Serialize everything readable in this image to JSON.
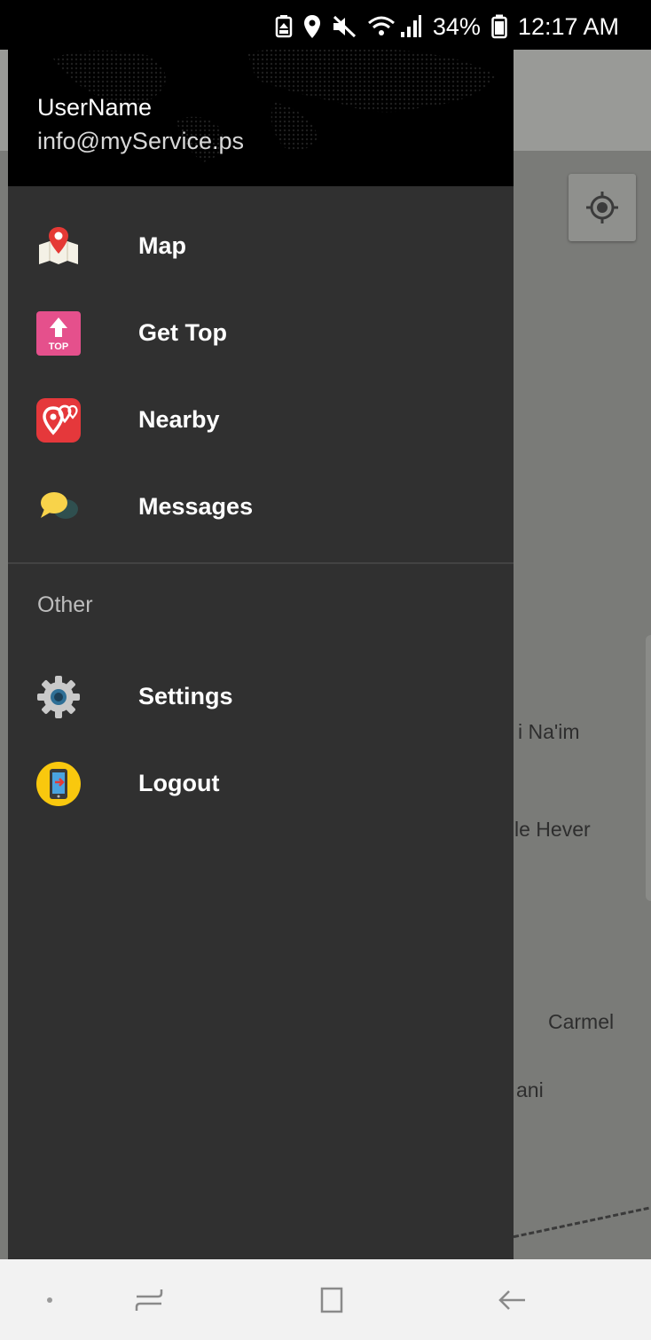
{
  "status_bar": {
    "battery_percent": "34%",
    "time": "12:17 AM"
  },
  "drawer": {
    "header": {
      "user_name": "UserName",
      "email": "info@myService.ps"
    },
    "main_items": [
      {
        "label": "Map",
        "icon": "map-pin-icon"
      },
      {
        "label": "Get Top",
        "icon": "top-arrow-icon"
      },
      {
        "label": "Nearby",
        "icon": "nearby-pins-icon"
      },
      {
        "label": "Messages",
        "icon": "chat-bubble-icon"
      }
    ],
    "section_title": "Other",
    "other_items": [
      {
        "label": "Settings",
        "icon": "gear-icon"
      },
      {
        "label": "Logout",
        "icon": "logout-phone-icon"
      }
    ]
  },
  "map": {
    "labels": [
      "i Na'im",
      "le Hever",
      "Carmel",
      "ani"
    ]
  },
  "colors": {
    "drawer_bg": "#303030",
    "header_bg": "#000000",
    "map_bg": "#7a7b78",
    "nav_bar_bg": "#f2f2f2"
  }
}
